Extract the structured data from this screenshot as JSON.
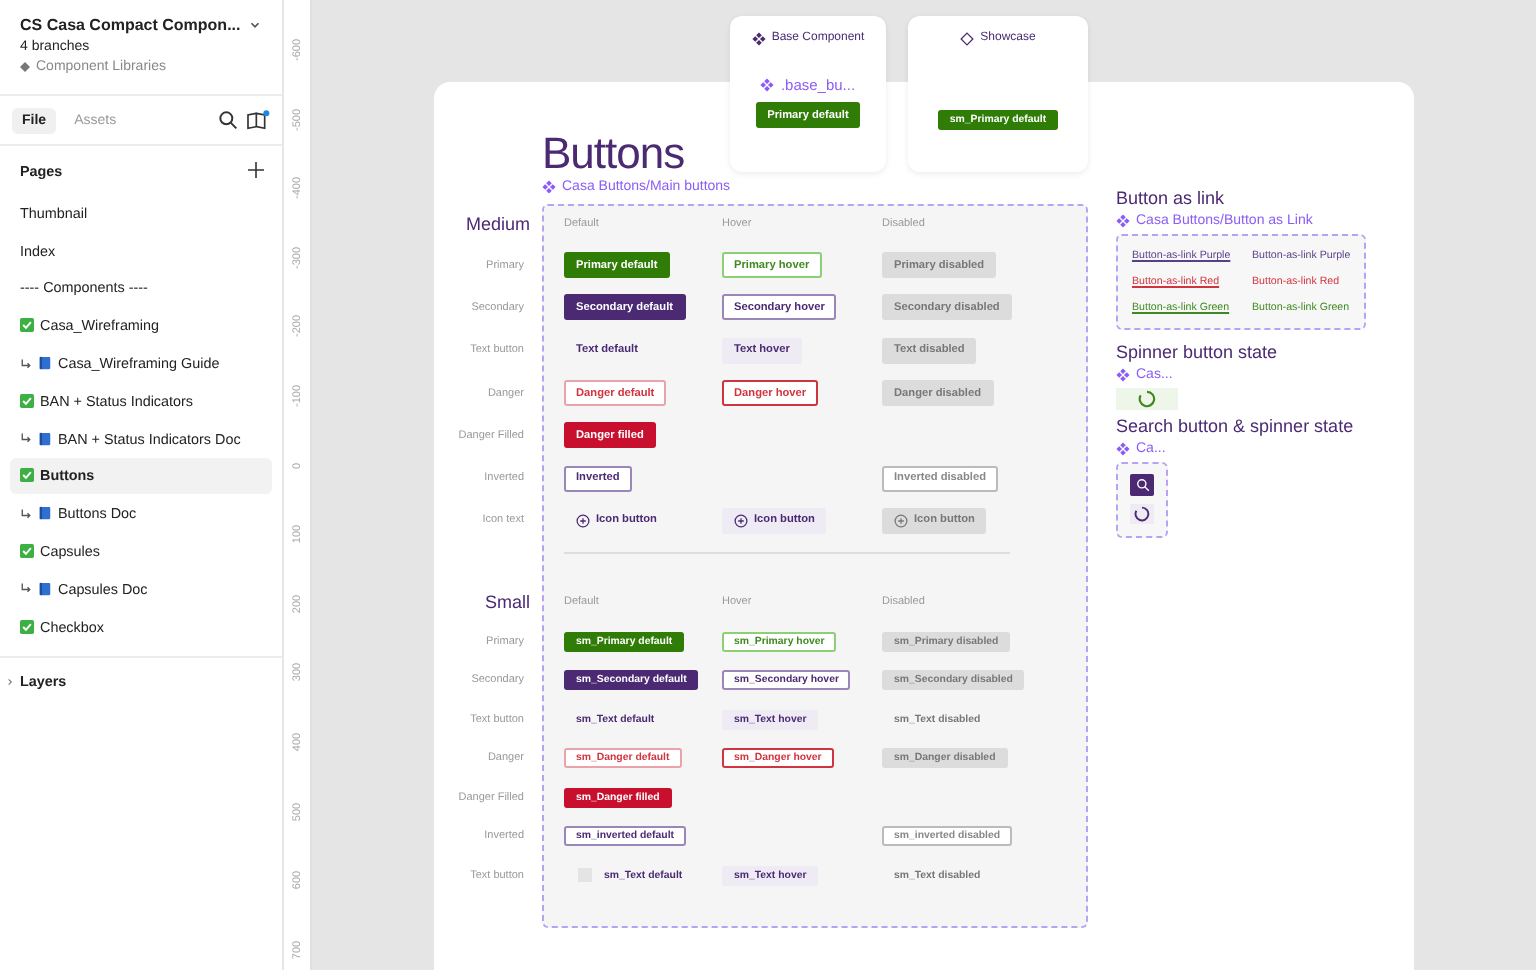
{
  "sidebar": {
    "file_title": "CS Casa Compact Compon...",
    "branches": "4 branches",
    "library": "Component Libraries",
    "tabs": [
      {
        "label": "File",
        "selected": true
      },
      {
        "label": "Assets",
        "selected": false
      }
    ],
    "pages_heading": "Pages",
    "pages": [
      {
        "label": "Thumbnail",
        "kind": "plain",
        "selected": false
      },
      {
        "label": "Index",
        "kind": "plain",
        "selected": false
      },
      {
        "label": "---- Components ----",
        "kind": "plain",
        "selected": false
      },
      {
        "label": "Casa_Wireframing",
        "kind": "check",
        "selected": false
      },
      {
        "label": "Casa_Wireframing Guide",
        "kind": "doc",
        "selected": false
      },
      {
        "label": "BAN + Status Indicators",
        "kind": "check",
        "selected": false
      },
      {
        "label": "BAN + Status Indicators Doc",
        "kind": "doc",
        "selected": false
      },
      {
        "label": "Buttons",
        "kind": "check",
        "selected": true
      },
      {
        "label": "Buttons Doc",
        "kind": "doc",
        "selected": false
      },
      {
        "label": "Capsules",
        "kind": "check",
        "selected": false
      },
      {
        "label": "Capsules Doc",
        "kind": "doc",
        "selected": false
      },
      {
        "label": "Checkbox",
        "kind": "check",
        "selected": false
      }
    ],
    "layers_heading": "Layers"
  },
  "ruler": {
    "ticks": [
      "-600",
      "-500",
      "-400",
      "-300",
      "-200",
      "-100",
      "0",
      "100",
      "200",
      "300",
      "400",
      "500",
      "600",
      "700"
    ]
  },
  "cards": [
    {
      "title": "Base Component",
      "kind": "component",
      "link": ".base_bu...",
      "button": "Primary default"
    },
    {
      "title": "Showcase",
      "kind": "showcase",
      "button": "sm_Primary default"
    }
  ],
  "frame": {
    "title": "Buttons",
    "component_link": "Casa Buttons/Main buttons",
    "sections": [
      {
        "title": "Medium",
        "kind": "medium",
        "columns": [
          "Default",
          "Hover",
          "Disabled"
        ],
        "rows": [
          {
            "label": "Primary",
            "kind": "primary",
            "cells": [
              {
                "text": "Primary default",
                "kind": "default"
              },
              {
                "text": "Primary hover",
                "kind": "hover"
              },
              {
                "text": "Primary disabled",
                "kind": "disabled"
              }
            ]
          },
          {
            "label": "Secondary",
            "kind": "secondary",
            "cells": [
              {
                "text": "Secondary default",
                "kind": "default"
              },
              {
                "text": "Secondary hover",
                "kind": "hover"
              },
              {
                "text": "Secondary disabled",
                "kind": "disabled"
              }
            ]
          },
          {
            "label": "Text button",
            "kind": "text",
            "cells": [
              {
                "text": "Text default",
                "kind": "default"
              },
              {
                "text": "Text hover",
                "kind": "hover"
              },
              {
                "text": "Text disabled",
                "kind": "disabled"
              }
            ]
          },
          {
            "label": "Danger",
            "kind": "danger",
            "cells": [
              {
                "text": "Danger default",
                "kind": "default"
              },
              {
                "text": "Danger hover",
                "kind": "hover"
              },
              {
                "text": "Danger disabled",
                "kind": "disabled"
              }
            ]
          },
          {
            "label": "Danger Filled",
            "kind": "danger-filled",
            "cells": [
              {
                "text": "Danger filled",
                "kind": "default"
              },
              null,
              null
            ]
          },
          {
            "label": "Inverted",
            "kind": "inverted",
            "cells": [
              {
                "text": "Inverted",
                "kind": "default"
              },
              null,
              {
                "text": "Inverted disabled",
                "kind": "disabled"
              }
            ]
          },
          {
            "label": "Icon text",
            "kind": "icon-text",
            "cells": [
              {
                "text": "Icon button",
                "kind": "default",
                "icon": true
              },
              {
                "text": "Icon button",
                "kind": "hover",
                "icon": true
              },
              {
                "text": "Icon button",
                "kind": "disabled",
                "icon": true
              }
            ]
          }
        ]
      },
      {
        "title": "Small",
        "kind": "small",
        "columns": [
          "Default",
          "Hover",
          "Disabled"
        ],
        "rows": [
          {
            "label": "Primary",
            "kind": "primary",
            "cells": [
              {
                "text": "sm_Primary default",
                "kind": "default"
              },
              {
                "text": "sm_Primary hover",
                "kind": "hover"
              },
              {
                "text": "sm_Primary disabled",
                "kind": "disabled"
              }
            ]
          },
          {
            "label": "Secondary",
            "kind": "secondary",
            "cells": [
              {
                "text": "sm_Secondary default",
                "kind": "default"
              },
              {
                "text": "sm_Secondary hover",
                "kind": "hover"
              },
              {
                "text": "sm_Secondary disabled",
                "kind": "disabled"
              }
            ]
          },
          {
            "label": "Text button",
            "kind": "text",
            "cells": [
              {
                "text": "sm_Text default",
                "kind": "default"
              },
              {
                "text": "sm_Text hover",
                "kind": "hover"
              },
              {
                "text": "sm_Text disabled",
                "kind": "disabled"
              }
            ]
          },
          {
            "label": "Danger",
            "kind": "danger",
            "cells": [
              {
                "text": "sm_Danger default",
                "kind": "default"
              },
              {
                "text": "sm_Danger hover",
                "kind": "hover"
              },
              {
                "text": "sm_Danger disabled",
                "kind": "disabled"
              }
            ]
          },
          {
            "label": "Danger Filled",
            "kind": "danger-filled",
            "cells": [
              {
                "text": "sm_Danger filled",
                "kind": "default"
              },
              null,
              null
            ]
          },
          {
            "label": "Inverted",
            "kind": "inverted",
            "cells": [
              {
                "text": "sm_inverted default",
                "kind": "default"
              },
              null,
              {
                "text": "sm_inverted disabled",
                "kind": "disabled"
              }
            ]
          },
          {
            "label": "Text button",
            "kind": "text",
            "cells": [
              {
                "text": "sm_Text default",
                "kind": "default",
                "icon": true
              },
              {
                "text": "sm_Text hover",
                "kind": "hover",
                "icon": false
              },
              {
                "text": "sm_Text disabled",
                "kind": "disabled",
                "icon": false
              }
            ]
          }
        ]
      }
    ]
  },
  "link_panel": {
    "title": "Button as link",
    "component_link": "Casa Buttons/Button as Link",
    "links": [
      {
        "text": "Button-as-link Purple",
        "color": "#5b3f86",
        "underlined": true
      },
      {
        "text": "Button-as-link Purple",
        "color": "#5b3f86",
        "underlined": false
      },
      {
        "text": "Button-as-link Red",
        "color": "#d0343f",
        "underlined": true
      },
      {
        "text": "Button-as-link Red",
        "color": "#d0343f",
        "underlined": false
      },
      {
        "text": "Button-as-link Green",
        "color": "#3f8a1f",
        "underlined": true
      },
      {
        "text": "Button-as-link Green",
        "color": "#3f8a1f",
        "underlined": false
      }
    ]
  },
  "spinner_panel": {
    "title": "Spinner button state",
    "component_link": "Cas..."
  },
  "search_panel": {
    "title": "Search button & spinner state",
    "component_link": "Ca..."
  }
}
